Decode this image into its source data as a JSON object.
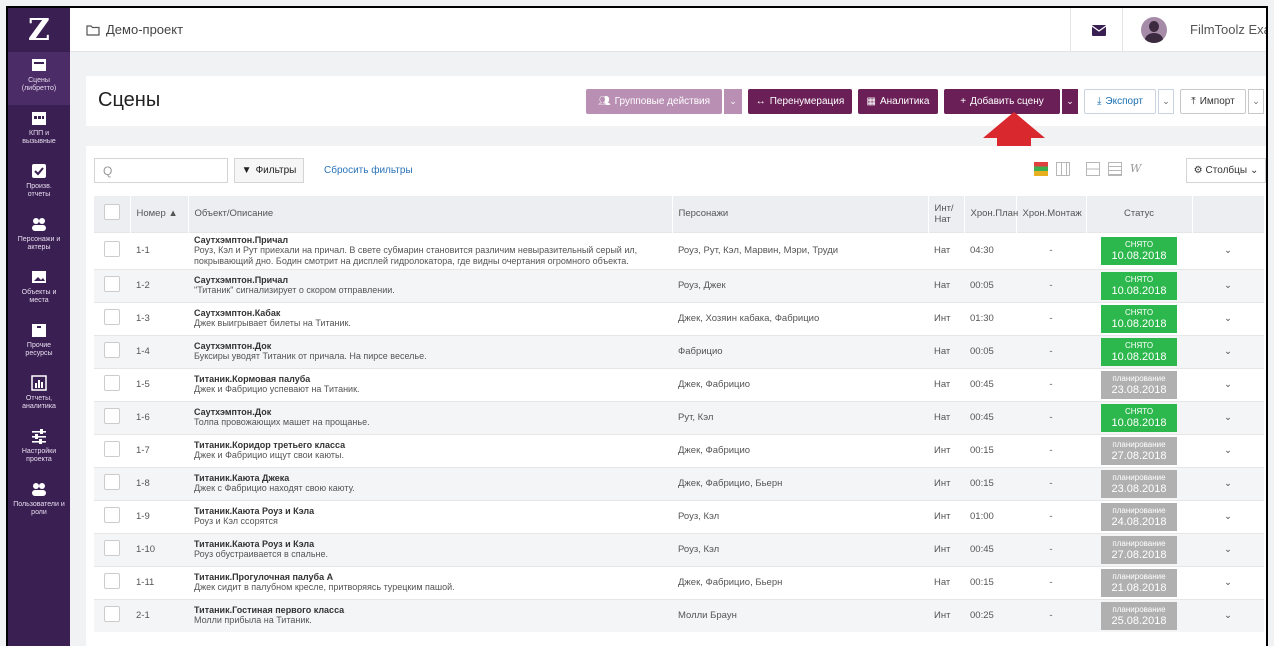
{
  "sidebar": {
    "logo": "Z",
    "items": [
      {
        "label": "Сцены\n(либретто)",
        "icon": "scenes-icon"
      },
      {
        "label": "КПП и\nвызывные",
        "icon": "calendar-icon"
      },
      {
        "label": "Произв.\nотчеты",
        "icon": "checkbox-icon"
      },
      {
        "label": "Персонажи и\nактеры",
        "icon": "people-icon"
      },
      {
        "label": "Объекты и\nместа",
        "icon": "image-icon"
      },
      {
        "label": "Прочие\nресурсы",
        "icon": "box-icon"
      },
      {
        "label": "Отчеты,\nаналитика",
        "icon": "chart-icon"
      },
      {
        "label": "Настройки\nпроекта",
        "icon": "sliders-icon"
      },
      {
        "label": "Пользователи и\nроли",
        "icon": "users-icon"
      }
    ]
  },
  "topbar": {
    "project": "Демо-проект",
    "user": "FilmToolz Examp"
  },
  "header": {
    "title": "Сцены",
    "group_actions": "Групповые действия",
    "renumber": "Перенумерация",
    "analytics": "Аналитика",
    "add_scene": "Добавить сцену",
    "export": "Экспорт",
    "import": "Импорт"
  },
  "toolbar": {
    "search_placeholder": "Q",
    "filters": "Фильтры",
    "reset": "Сбросить фильтры",
    "columns": "Столбцы"
  },
  "columns": {
    "number": "Номер ▲",
    "object": "Объект/Описание",
    "characters": "Персонажи",
    "intnat": "Инт/ Нат",
    "chron_plan": "Хрон.План",
    "chron_edit": "Хрон.Монтаж",
    "status": "Статус"
  },
  "colors": {
    "sidebar": "#3a1f52",
    "done": "#2db84d",
    "planning": "#b0b0b0",
    "add": "#6a1f57",
    "group": "#b98fb3",
    "arrow": "#d9282e"
  },
  "rows": [
    {
      "num": "1-1",
      "title": "Саутхэмптон.Причал",
      "desc": "Роуз, Кэл и Рут приехали на причал. В свете субмарин становится различим невыразительный серый ил, покрывающий дно. Бодин смотрит на дисплей гидролокатора, где видны очертания огромного объекта.",
      "chars": "Роуз, Рут, Кэл, Марвин, Мэри, Труди",
      "io": "Нат",
      "plan": "04:30",
      "edit": "-",
      "status": "СНЯТО",
      "date": "10.08.2018",
      "kind": "done"
    },
    {
      "num": "1-2",
      "title": "Саутхэмптон.Причал",
      "desc": "\"Титаник\" сигнализирует о скором отправлении.",
      "chars": "Роуз, Джек",
      "io": "Нат",
      "plan": "00:05",
      "edit": "-",
      "status": "СНЯТО",
      "date": "10.08.2018",
      "kind": "done"
    },
    {
      "num": "1-3",
      "title": "Саутхэмптон.Кабак",
      "desc": "Джек выигрывает билеты на Титаник.",
      "chars": "Джек, Хозяин кабака, Фабрицио",
      "io": "Инт",
      "plan": "01:30",
      "edit": "-",
      "status": "СНЯТО",
      "date": "10.08.2018",
      "kind": "done"
    },
    {
      "num": "1-4",
      "title": "Саутхэмптон.Док",
      "desc": "Буксиры уводят Титаник от причала. На пирсе веселье.",
      "chars": "Фабрицио",
      "io": "Нат",
      "plan": "00:05",
      "edit": "-",
      "status": "СНЯТО",
      "date": "10.08.2018",
      "kind": "done"
    },
    {
      "num": "1-5",
      "title": "Титаник.Кормовая палуба",
      "desc": "Джек и Фабрицио успевают на Титаник.",
      "chars": "Джек, Фабрицио",
      "io": "Нат",
      "plan": "00:45",
      "edit": "-",
      "status": "планирование",
      "date": "23.08.2018",
      "kind": "plan"
    },
    {
      "num": "1-6",
      "title": "Саутхэмптон.Док",
      "desc": "Толпа провожающих машет на прощанье.",
      "chars": "Рут, Кэл",
      "io": "Нат",
      "plan": "00:45",
      "edit": "-",
      "status": "СНЯТО",
      "date": "10.08.2018",
      "kind": "done"
    },
    {
      "num": "1-7",
      "title": "Титаник.Коридор третьего класса",
      "desc": "Джек и Фабрицио ищут свои каюты.",
      "chars": "Джек, Фабрицио",
      "io": "Инт",
      "plan": "00:15",
      "edit": "-",
      "status": "планирование",
      "date": "27.08.2018",
      "kind": "plan"
    },
    {
      "num": "1-8",
      "title": "Титаник.Каюта Джека",
      "desc": "Джек с Фабрицио находят свою каюту.",
      "chars": "Джек, Фабрицио, Бьерн",
      "io": "Инт",
      "plan": "00:15",
      "edit": "-",
      "status": "планирование",
      "date": "23.08.2018",
      "kind": "plan"
    },
    {
      "num": "1-9",
      "title": "Титаник.Каюта Роуз и Кэла",
      "desc": "Роуз и Кэл ссорятся",
      "chars": "Роуз, Кэл",
      "io": "Инт",
      "plan": "01:00",
      "edit": "-",
      "status": "планирование",
      "date": "24.08.2018",
      "kind": "plan"
    },
    {
      "num": "1-10",
      "title": "Титаник.Каюта Роуз и Кэла",
      "desc": "Роуз обустраивается в спальне.",
      "chars": "Роуз, Кэл",
      "io": "Инт",
      "plan": "00:45",
      "edit": "-",
      "status": "планирование",
      "date": "27.08.2018",
      "kind": "plan"
    },
    {
      "num": "1-11",
      "title": "Титаник.Прогулочная палуба А",
      "desc": "Джек сидит в палубном кресле, притворяясь турецким пашой.",
      "chars": "Джек, Фабрицио, Бьерн",
      "io": "Нат",
      "plan": "00:15",
      "edit": "-",
      "status": "планирование",
      "date": "21.08.2018",
      "kind": "plan"
    },
    {
      "num": "2-1",
      "title": "Титаник.Гостиная первого класса",
      "desc": "Молли прибыла на Титаник.",
      "chars": "Молли Браун",
      "io": "Инт",
      "plan": "00:25",
      "edit": "-",
      "status": "планирование",
      "date": "25.08.2018",
      "kind": "plan"
    }
  ]
}
